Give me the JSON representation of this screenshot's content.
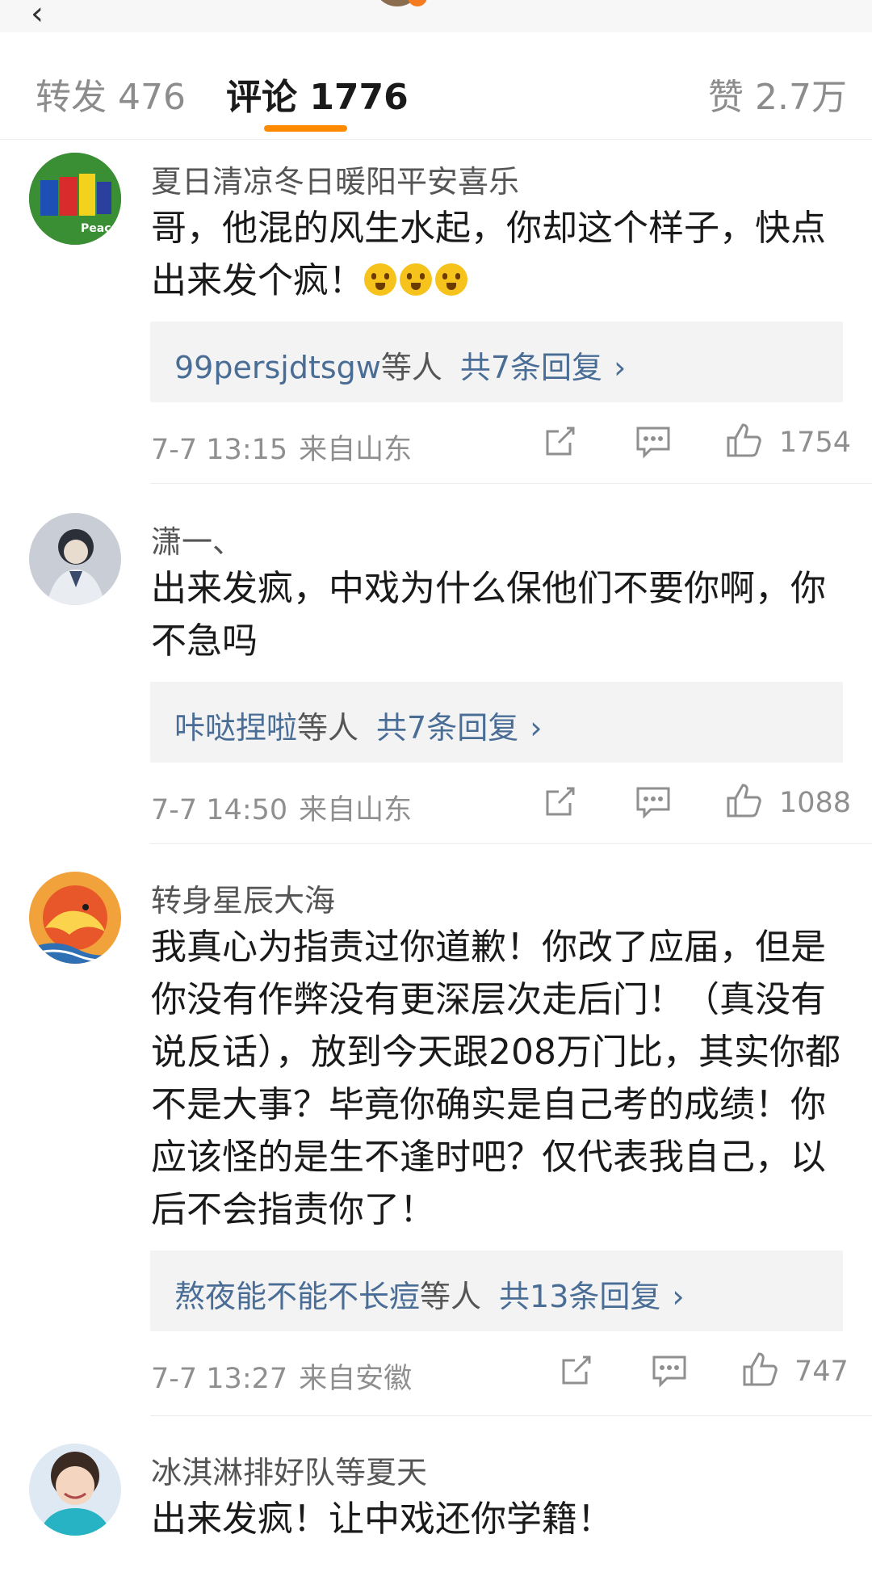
{
  "tabs": {
    "repost": "转发 476",
    "comments": "评论 1776",
    "likes": "赞 2.7万"
  },
  "comments": [
    {
      "user": "夏日清凉冬日暖阳平安喜乐",
      "text": "哥，他混的风生水起，你却这个样子，快点出来发个疯！",
      "emoji": "😱😱😱",
      "reply_user": "99persjdtsgw",
      "reply_others": "等人",
      "reply_count": "共7条回复",
      "reply_arrow": "›",
      "time": "7-7 13:15",
      "location": "来自山东",
      "likes": "1754"
    },
    {
      "user": "潇一、",
      "text": "出来发疯，中戏为什么保他们不要你啊，你不急吗",
      "reply_user": "咔哒捏啦",
      "reply_others": "等人",
      "reply_count": "共7条回复",
      "reply_arrow": "›",
      "time": "7-7 14:50",
      "location": "来自山东",
      "likes": "1088"
    },
    {
      "user": "转身星辰大海",
      "text": "我真心为指责过你道歉！你改了应届，但是你没有作弊没有更深层次走后门！（真没有说反话），放到今天跟208万门比，其实你都不是大事？毕竟你确实是自己考的成绩！你应该怪的是生不逢时吧？仅代表我自己，以后不会指责你了！",
      "reply_user": "熬夜能不能不长痘",
      "reply_others": "等人",
      "reply_count": "共13条回复",
      "reply_arrow": "›",
      "time": "7-7 13:27",
      "location": "来自安徽",
      "likes": "747"
    },
    {
      "user": "冰淇淋排好队等夏天",
      "text": "出来发疯！让中戏还你学籍！"
    }
  ],
  "icons": {
    "repost": "share-out-icon",
    "comment": "comment-bubble-icon",
    "like": "thumbs-up-icon"
  },
  "colors": {
    "accent": "#ff8a00",
    "link": "#4a6d96",
    "meta": "#8f8f8f"
  }
}
